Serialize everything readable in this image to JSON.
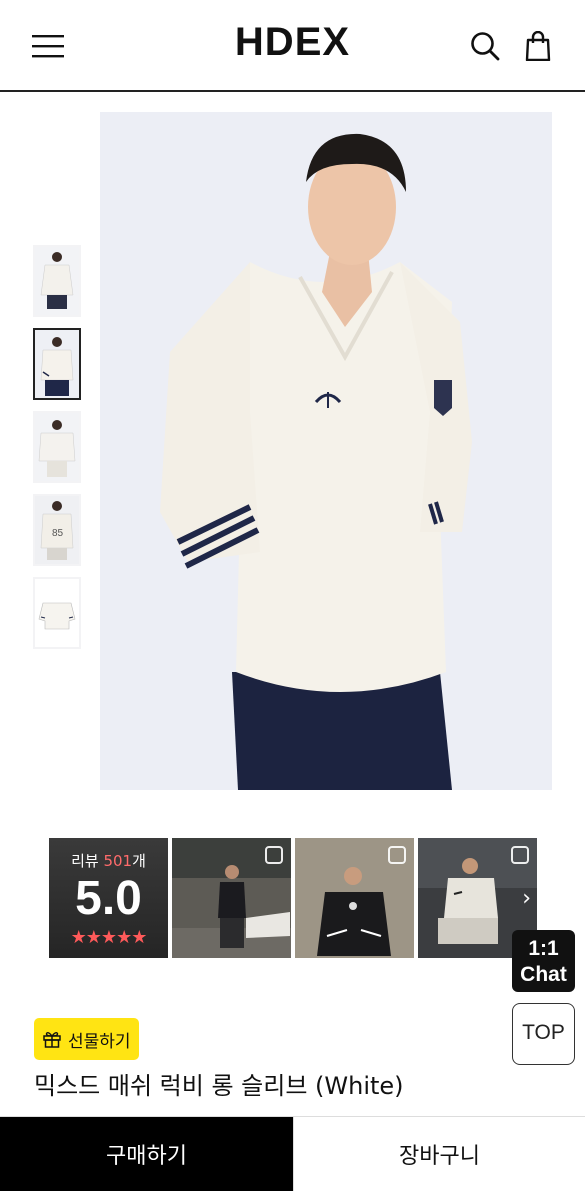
{
  "header": {
    "logo": "HDEX",
    "menu_icon": "hamburger-menu-icon",
    "search_icon": "search-icon",
    "cart_icon": "shopping-bag-icon"
  },
  "gallery": {
    "thumbnail_count": 5,
    "active_thumbnail": 1,
    "colors": {
      "background": "#eef0f7",
      "shirt": "#f4f1ea",
      "stripe": "#1f2748",
      "pants": "#1c2340"
    }
  },
  "reviews": {
    "label_prefix": "리뷰 ",
    "count": "501",
    "label_suffix": "개",
    "score": "5.0",
    "stars": "★★★★★",
    "star_color": "#ff5a5a",
    "next_icon": "chevron-right-icon"
  },
  "floating": {
    "chat_line1": "1:1",
    "chat_line2": "Chat",
    "top_label": "TOP"
  },
  "product": {
    "gift_label": "선물하기",
    "gift_icon": "gift-icon",
    "gift_color": "#ffe413",
    "title": "믹스드 매쉬 럭비 롱 슬리브 (White)"
  },
  "bottom_bar": {
    "buy_label": "구매하기",
    "cart_label": "장바구니"
  }
}
